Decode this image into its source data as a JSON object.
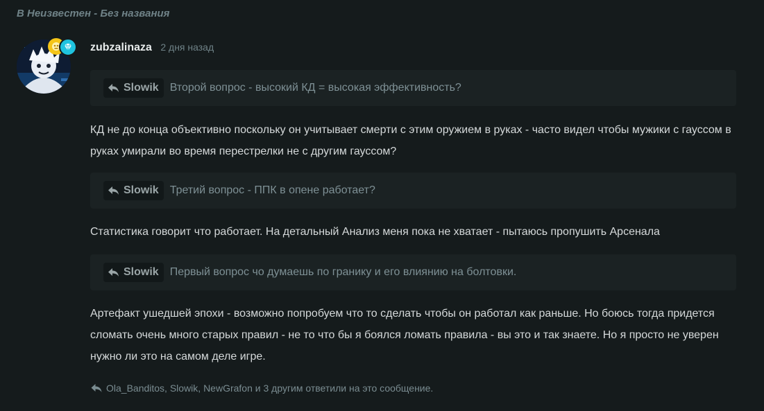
{
  "context": "В Неизвестен - Без названия",
  "post": {
    "username": "zubzalinaza",
    "timestamp": "2 дня назад",
    "badges": [
      "gold-badge-icon",
      "diamond-badge-icon"
    ],
    "blocks": [
      {
        "type": "quote",
        "author": "Slowik",
        "text": "Второй вопрос - высокий КД = высокая эффективность?"
      },
      {
        "type": "text",
        "text": "КД не до конца объективно поскольку он учитывает смерти с этим оружием в руках - часто видел чтобы мужики с гауссом в руках умирали во время перестрелки не с другим гауссом?"
      },
      {
        "type": "quote",
        "author": "Slowik",
        "text": "Третий вопрос - ППК в опене работает?"
      },
      {
        "type": "text",
        "text": "Статистика говорит что работает. На детальный Анализ меня пока не хватает - пытаюсь пропушить Арсенала"
      },
      {
        "type": "quote",
        "author": "Slowik",
        "text": "Первый вопрос чо думаешь по гранику и его влиянию на болтовки."
      },
      {
        "type": "text",
        "text": "Артефакт ушедшей эпохи - возможно попробуем что то сделать чтобы он работал как раньше. Но боюсь тогда придется сломать очень много старых правил - не то что бы я боялся ломать правила - вы это и так знаете. Но я просто не уверен нужно ли это на самом деле игре."
      }
    ],
    "replies_summary": "Ola_Banditos, Slowik, NewGrafon и 3 другим ответили на это сообщение."
  },
  "colors": {
    "background": "#151b1c",
    "quote_background": "#1b2223",
    "badge_gold": "#f5c518",
    "badge_diamond": "#1fc3df"
  }
}
